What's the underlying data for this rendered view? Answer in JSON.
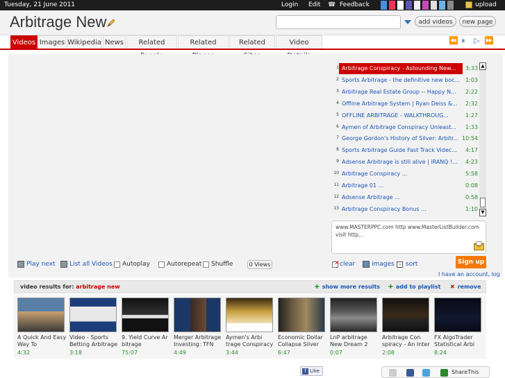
{
  "topbar": {
    "date": "Tuesday, 21 June 2011",
    "login": "Login",
    "edit": "Edit",
    "feedback": "Feedback",
    "upload": "upload",
    "swatches": [
      "#4a90d9",
      "#e23a55",
      "#ffffff",
      "#5a5aaa",
      "#f3f3f3",
      "#c64bb8",
      "#e0e0e0",
      "#6ab3e8",
      "#888888"
    ]
  },
  "header": {
    "title": "Arbitrage New",
    "add_videos": "add videos",
    "new_page": "new page"
  },
  "tabs": [
    "Videos",
    "Images",
    "Wikipedia",
    "News",
    "Related People",
    "Related Places",
    "Related Sites",
    "Video Details"
  ],
  "playlist": [
    {
      "n": "1",
      "title": "Arbitrage Conspiracy - Astounding New...",
      "dur": "3:33"
    },
    {
      "n": "2",
      "title": "Sports Arbitrage - the definitive new boc...",
      "dur": "1:03"
    },
    {
      "n": "3",
      "title": "Arbitrage Real Estate Group -- Happy N...",
      "dur": "2:22"
    },
    {
      "n": "4",
      "title": "Offline Arbitrage System | Ryan Deiss &...",
      "dur": "2:32"
    },
    {
      "n": "5",
      "title": "OFFLINE ARBITRAGE - WALKTHROUG...",
      "dur": "1:27"
    },
    {
      "n": "6",
      "title": "Aymen of Arbitrage Conspiracy Unleast...",
      "dur": "1:33"
    },
    {
      "n": "7",
      "title": "George Gordon's History of Silver: Arbitr...",
      "dur": "10:54"
    },
    {
      "n": "8",
      "title": "Sports Arbitrage Guide Fast Track Videc...",
      "dur": "4:17"
    },
    {
      "n": "9",
      "title": "Adsense Arbitrage is still alive | iRANQ !...",
      "dur": "4:23"
    },
    {
      "n": "10",
      "title": "Arbitrage Conspiracy                ...",
      "dur": "5:58"
    },
    {
      "n": "11",
      "title": "Arbitrage 01                              ...",
      "dur": "0:08"
    },
    {
      "n": "12",
      "title": "Adsense Arbitrage                      ...",
      "dur": "0:58"
    },
    {
      "n": "13",
      "title": "Arbitrage Conspiracy Bonus          ...",
      "dur": "1:10"
    }
  ],
  "textbox": "www.MASTERPPC.com http www.MasterListBuilder.com visit http...",
  "controls": {
    "play_next": "Play next",
    "list_all": "List all Videos",
    "autoplay": "Autoplay",
    "autorepeat": "Autorepeat",
    "shuffle": "Shuffle",
    "views": "0 Views",
    "clear": "clear",
    "images": "images",
    "sort": "sort",
    "signup": "Sign up",
    "have_account": "I have an account, log"
  },
  "results": {
    "label": "video results for:",
    "query": "arbitrage new",
    "show_more": "show more results",
    "add_playlist": "add to playlist",
    "remove": "remove"
  },
  "thumbs": [
    {
      "caption": "A Quick And Easy Way To",
      "dur": "4:32"
    },
    {
      "caption": "Video - Sports Betting Arbitrage",
      "dur": "3:18"
    },
    {
      "caption": "9. Yield Curve Ar bitrage",
      "dur": "75:07"
    },
    {
      "caption": "Merger Arbitrage Investing: TFN",
      "dur": "4:49"
    },
    {
      "caption": "Aymen's Arbi trage Conspiracy",
      "dur": "3:44"
    },
    {
      "caption": "Economic Dollar Collapse Silver",
      "dur": "6:47"
    },
    {
      "caption": "LnP arbitrage New Dream 2",
      "dur": "0:07"
    },
    {
      "caption": "Arbitrage Con spiracy - An Inter",
      "dur": "2:08"
    },
    {
      "caption": "FX AlgoTrader Statistical Arbi",
      "dur": "8:24"
    }
  ],
  "footer": {
    "like": "Like",
    "share": "ShareThis"
  }
}
